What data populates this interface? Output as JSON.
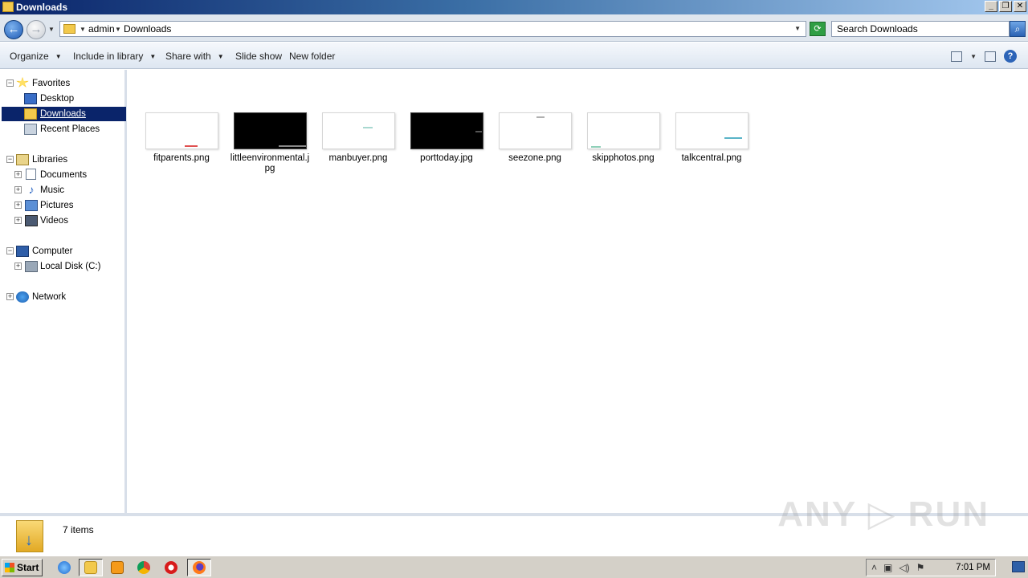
{
  "window": {
    "title": "Downloads",
    "minimize": "_",
    "maximize": "❐",
    "close": "✕"
  },
  "address": {
    "crumbs": [
      "admin",
      "Downloads"
    ],
    "search_placeholder": "Search Downloads"
  },
  "toolbar": {
    "organize": "Organize",
    "include_in_library": "Include in library",
    "share_with": "Share with",
    "slide_show": "Slide show",
    "new_folder": "New folder",
    "help": "?"
  },
  "nav": {
    "favorites": "Favorites",
    "desktop": "Desktop",
    "downloads": "Downloads",
    "recent_places": "Recent Places",
    "libraries": "Libraries",
    "documents": "Documents",
    "music": "Music",
    "pictures": "Pictures",
    "videos": "Videos",
    "computer": "Computer",
    "local_disk": "Local Disk (C:)",
    "network": "Network"
  },
  "files": [
    {
      "name": "fitparents.png",
      "dark": false,
      "accent": "#e05050"
    },
    {
      "name": "littleenvironmental.jpg",
      "dark": true,
      "accent": "#888888"
    },
    {
      "name": "manbuyer.png",
      "dark": false,
      "accent": "#a8d8d0"
    },
    {
      "name": "porttoday.jpg",
      "dark": true,
      "accent": "#555555"
    },
    {
      "name": "seezone.png",
      "dark": false,
      "accent": "#b0b0b0"
    },
    {
      "name": "skipphotos.png",
      "dark": false,
      "accent": "#8fd0b8"
    },
    {
      "name": "talkcentral.png",
      "dark": false,
      "accent": "#5ab4c8"
    }
  ],
  "status": {
    "item_count": "7 items",
    "watermark": "ANY ▷ RUN"
  },
  "taskbar": {
    "start": "Start",
    "clock": "7:01 PM"
  }
}
